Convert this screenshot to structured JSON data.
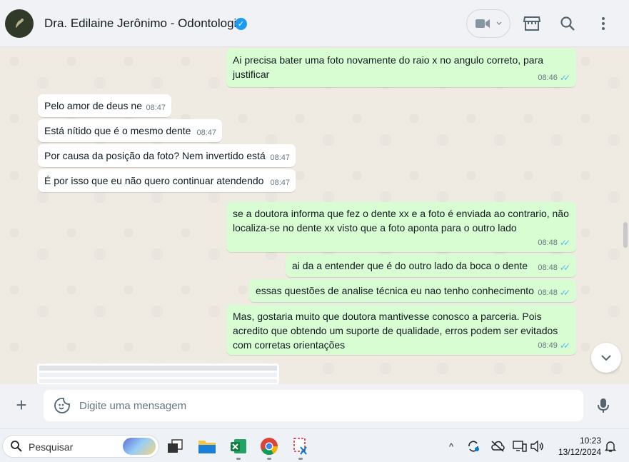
{
  "header": {
    "contact_name": "Dra. Edilaine Jerônimo - Odontologia",
    "verified_glyph": "✓",
    "icons": [
      "video-call-icon",
      "catalog-icon",
      "search-icon",
      "more-options-icon"
    ]
  },
  "messages": [
    {
      "dir": "out",
      "text": "Ai precisa bater uma foto novamente do raio x no angulo correto, para justificar",
      "time": "08:46"
    },
    {
      "dir": "in",
      "text": "Pelo amor de deus ne",
      "time": "08:47"
    },
    {
      "dir": "in",
      "text": "Está nítido que é o mesmo dente",
      "time": "08:47"
    },
    {
      "dir": "in",
      "text": "Por causa da posição da foto? Nem invertido está",
      "time": "08:47"
    },
    {
      "dir": "in",
      "text": "É por isso que eu não quero continuar atendendo",
      "time": "08:47"
    },
    {
      "dir": "out",
      "text": "se a doutora informa que fez o dente xx e a foto é enviada ao contrario, não localiza-se no dente xx visto que a foto aponta para o outro lado",
      "time": "08:48"
    },
    {
      "dir": "out",
      "text": "ai da a entender que é do outro lado da boca o dente",
      "time": "08:48"
    },
    {
      "dir": "out",
      "text": "essas questões de analise técnica eu nao tenho conhecimento",
      "time": "08:48"
    },
    {
      "dir": "out",
      "text": "Mas, gostaria muito que doutora mantivesse conosco a parceria. Pois acredito que obtendo um suporte de qualidade, erros podem ser evitados com corretas orientações",
      "time": "08:49"
    }
  ],
  "composer": {
    "placeholder": "Digite uma mensagem",
    "attach_glyph": "+"
  },
  "taskbar": {
    "search_placeholder": "Pesquisar",
    "apps": [
      "task-view",
      "file-explorer",
      "excel",
      "chrome",
      "snipping-tool"
    ],
    "time": "10:23",
    "date": "13/12/2024",
    "tray_chevron": "^"
  },
  "colors": {
    "outgoing_bubble": "#d9fdd3",
    "incoming_bubble": "#ffffff",
    "chat_bg": "#efeae2",
    "read_ticks": "#53bdeb",
    "verified": "#1d9bf0"
  }
}
